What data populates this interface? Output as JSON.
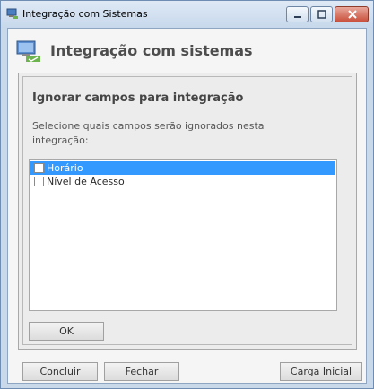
{
  "window": {
    "title": "Integração com Sistemas",
    "controls": [
      "minimize-icon",
      "maximize-icon",
      "close-icon"
    ]
  },
  "header": {
    "title": "Integração com sistemas",
    "icon": "monitor-check-icon"
  },
  "section": {
    "title": "Ignorar campos para integração",
    "description": "Selecione quais campos serão ignorados nesta integração:"
  },
  "fields": [
    {
      "label": "Horário",
      "checked": false,
      "selected": true
    },
    {
      "label": "Nível de Acesso",
      "checked": false,
      "selected": false
    }
  ],
  "buttons": {
    "ok": "OK",
    "concluir": "Concluir",
    "fechar": "Fechar",
    "carga_inicial": "Carga Inicial"
  },
  "colors": {
    "selection": "#3399ff",
    "close_button": "#c9503c"
  }
}
